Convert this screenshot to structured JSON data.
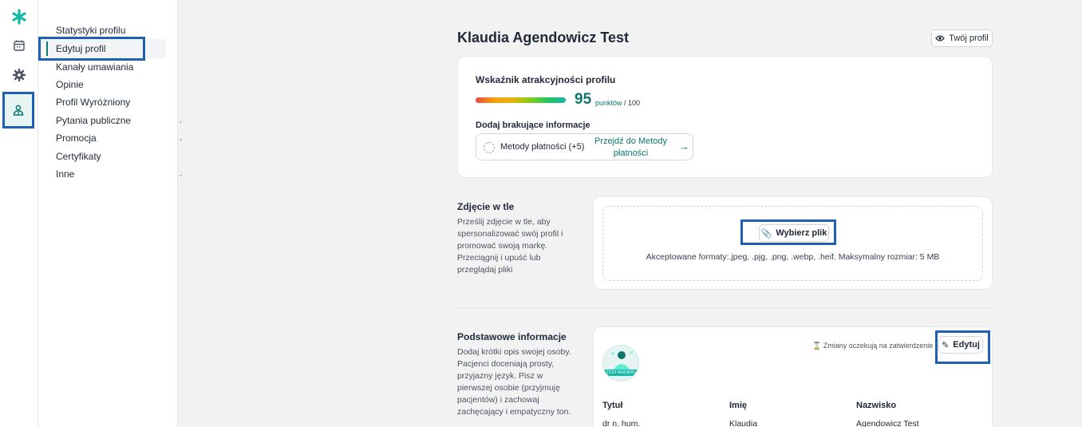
{
  "sidebar": {
    "items": [
      {
        "label": "Statystyki profilu",
        "chevron": false
      },
      {
        "label": "Edytuj profil",
        "chevron": false,
        "active": true
      },
      {
        "label": "Kanały umawiania",
        "chevron": false
      },
      {
        "label": "Opinie",
        "chevron": false
      },
      {
        "label": "Profil Wyróżniony",
        "chevron": false
      },
      {
        "label": "Pytania publiczne",
        "chevron": true
      },
      {
        "label": "Promocja",
        "chevron": true
      },
      {
        "label": "Certyfikaty",
        "chevron": false
      },
      {
        "label": "Inne",
        "chevron": true
      }
    ]
  },
  "header": {
    "title": "Klaudia Agendowicz Test",
    "profile_button": "Twój profil"
  },
  "score_card": {
    "title": "Wskaźnik atrakcyjności profilu",
    "score": "95",
    "unit_label": "punktów",
    "unit_max": "/ 100",
    "missing_label": "Dodaj brakujące informacje",
    "missing_item": "Metody płatności (+5)",
    "missing_link": "Przejdź do Metody płatności"
  },
  "background_photo": {
    "title": "Zdjęcie w tle",
    "description": "Prześlij zdjęcie w tle, aby spersonalizować swój profil i promować swoją markę. Przeciągnij i upuść lub przeglądaj pliki",
    "choose_file": "Wybierz plik",
    "formats": "Akceptowane formaty:.jpeg, .pjg, .png, .webp, .heif. Maksymalny rozmiar: 5 MB"
  },
  "basic_info": {
    "title": "Podstawowe informacje",
    "description": "Dodaj krótki opis swojej osoby. Pacjenci doceniają prosty, przyjazny język. Pisz w pierwszej osobie (przyjmuję pacjentów) i zachowaj zachęcający i empatyczny ton.",
    "pending": "Zmiany oczekują na zatwierdzenie",
    "edit_button": "Edytuj",
    "avatar_text": "TEST AGENDO",
    "columns": [
      {
        "header": "Tytuł",
        "value": "dr n. hum."
      },
      {
        "header": "Imię",
        "value": "Klaudia"
      },
      {
        "header": "Nazwisko",
        "value": "Agendowicz Test"
      }
    ]
  },
  "colors": {
    "accent": "#0f766e",
    "highlight": "#1f5fb5"
  }
}
